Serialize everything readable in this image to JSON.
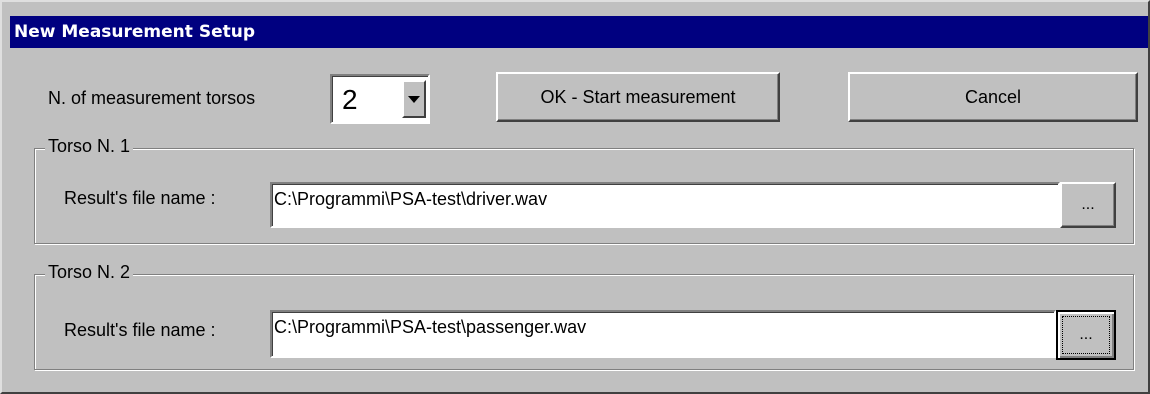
{
  "window": {
    "title": "New Measurement Setup"
  },
  "torsos": {
    "label": "N. of measurement torsos",
    "selected_value": "2"
  },
  "toolbar": {
    "ok_label": "OK - Start measurement",
    "cancel_label": "Cancel"
  },
  "groups": [
    {
      "legend": "Torso N. 1",
      "file_label": "Result's file name :",
      "file_value": "C:\\Programmi\\PSA-test\\driver.wav",
      "browse_label": "..."
    },
    {
      "legend": "Torso N. 2",
      "file_label": "Result's file name :",
      "file_value": "C:\\Programmi\\PSA-test\\passenger.wav",
      "browse_label": "..."
    }
  ],
  "colors": {
    "titlebar_bg": "#000080",
    "titlebar_fg": "#ffffff",
    "face": "#c0c0c0"
  },
  "icons": {
    "dropdown": "chevron-down-icon"
  }
}
